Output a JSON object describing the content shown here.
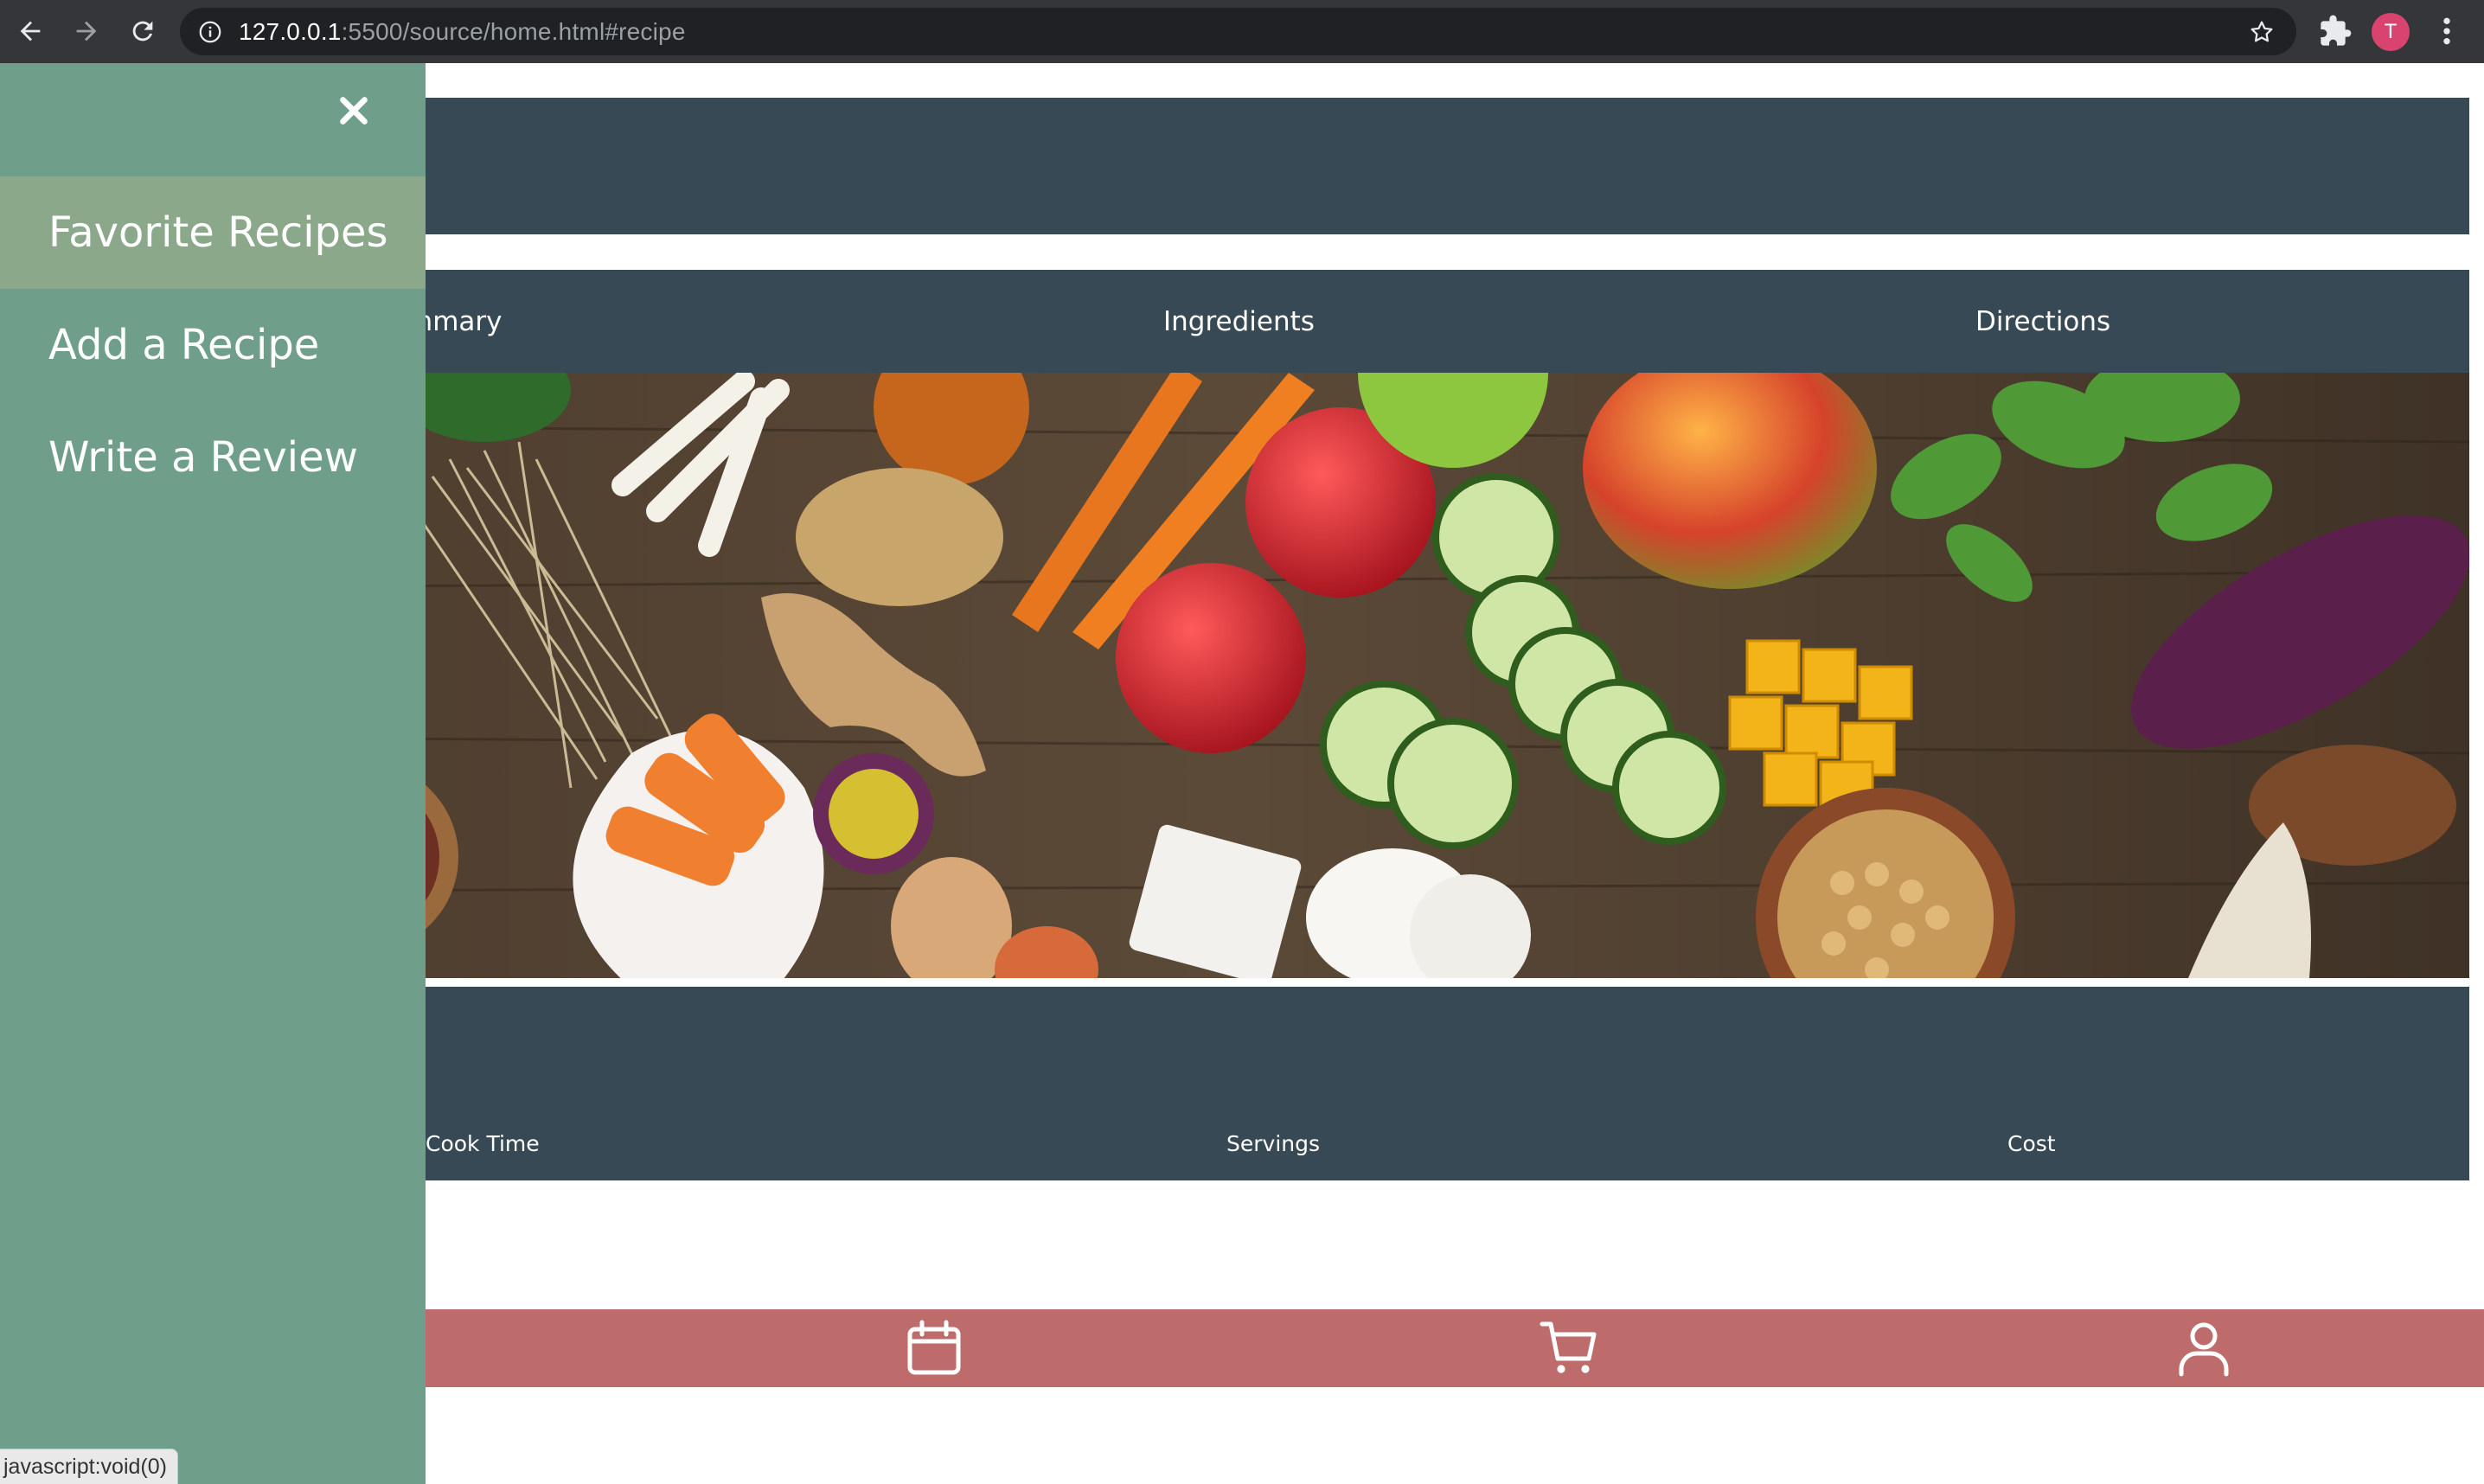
{
  "browser": {
    "url_host": "127.0.0.1",
    "url_rest": ":5500/source/home.html#recipe",
    "profile_initial": "T",
    "icons": {
      "back": "arrow-left-icon",
      "forward": "arrow-right-icon",
      "reload": "reload-icon",
      "info": "info-icon",
      "bookmark": "star-icon",
      "extensions": "puzzle-icon",
      "menu": "kebab-icon"
    }
  },
  "sidenav": {
    "close_icon": "close-icon",
    "items": [
      {
        "label": "Favorite Recipes",
        "active": true
      },
      {
        "label": "Add a Recipe",
        "active": false
      },
      {
        "label": "Write a Review",
        "active": false
      }
    ]
  },
  "recipe": {
    "tabs": [
      "mmary",
      "Ingredients",
      "Directions"
    ],
    "stats": [
      "Cook Time",
      "Servings",
      "Cost"
    ]
  },
  "bottom_nav": {
    "icons": [
      "calendar-icon",
      "cart-icon",
      "user-icon"
    ]
  },
  "status_bar": {
    "text": "javascript:void(0)"
  },
  "colors": {
    "sidenav_bg": "#6f9e8b",
    "sidenav_active": "#8ba88a",
    "band": "#374955",
    "bottom_bar": "#bd6b6b"
  }
}
